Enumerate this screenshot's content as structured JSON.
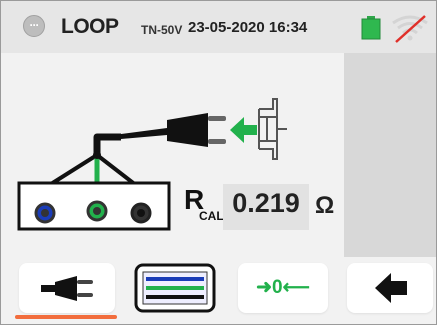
{
  "status_bar": {
    "menu_icon": "ellipsis-icon",
    "mode": "LOOP",
    "mode_subtitle": "TN-50V",
    "datetime": "23-05-2020  16:34",
    "battery_icon": "battery-icon",
    "wifi_icon": "wifi-disabled-icon"
  },
  "measurement": {
    "label": "R",
    "label_subscript": "CAL",
    "value": "0.219",
    "unit": "Ω"
  },
  "toolbar": {
    "plug_icon": "plug-icon",
    "leads_icon": "test-leads-icon",
    "zero_label": "➜0⟵",
    "back_icon": "back-arrow-icon"
  },
  "colors": {
    "green": "#22b14c",
    "blue": "#1a3cb8",
    "accent": "#f26d3d"
  }
}
